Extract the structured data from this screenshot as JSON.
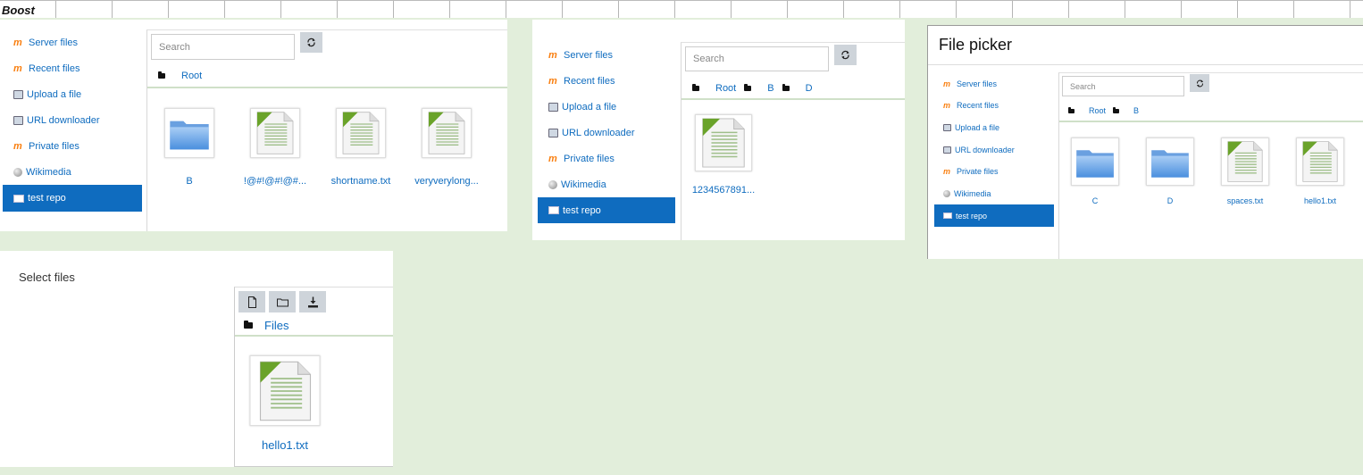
{
  "window": {
    "theme_label": "Boost"
  },
  "repositories": [
    {
      "label": "Server files",
      "icon": "moodle-icon"
    },
    {
      "label": "Recent files",
      "icon": "moodle-icon"
    },
    {
      "label": "Upload a file",
      "icon": "upload-icon"
    },
    {
      "label": "URL downloader",
      "icon": "upload-icon"
    },
    {
      "label": "Private files",
      "icon": "moodle-icon"
    },
    {
      "label": "Wikimedia",
      "icon": "globe-icon"
    },
    {
      "label": "test repo",
      "icon": "repo-icon",
      "active": true
    }
  ],
  "picker1": {
    "search_placeholder": "Search",
    "breadcrumb": [
      "Root"
    ],
    "files": [
      {
        "name": "B",
        "type": "folder"
      },
      {
        "name": "!@#!@#!@#...",
        "type": "file"
      },
      {
        "name": "shortname.txt",
        "type": "file"
      },
      {
        "name": "veryverylong...",
        "type": "file"
      }
    ]
  },
  "picker2": {
    "search_placeholder": "Search",
    "breadcrumb": [
      "Root",
      "B",
      "D"
    ],
    "files": [
      {
        "name": "1234567891...",
        "type": "file"
      }
    ]
  },
  "picker3": {
    "title": "File picker",
    "search_placeholder": "Search",
    "breadcrumb": [
      "Root",
      "B"
    ],
    "files": [
      {
        "name": "C",
        "type": "folder"
      },
      {
        "name": "D",
        "type": "folder"
      },
      {
        "name": "spaces.txt",
        "type": "file"
      },
      {
        "name": "hello1.txt",
        "type": "file"
      }
    ]
  },
  "filemanager": {
    "label": "Select files",
    "breadcrumb": [
      "Files"
    ],
    "files": [
      {
        "name": "hello1.txt",
        "type": "file"
      }
    ]
  },
  "colors": {
    "accent": "#0f6cbf",
    "background": "#e2eedb",
    "button": "#ced4da"
  }
}
